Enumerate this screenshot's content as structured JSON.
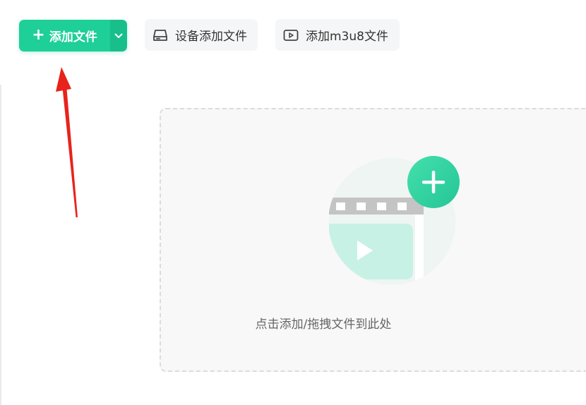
{
  "toolbar": {
    "add_file_label": "添加文件",
    "device_add_label": "设备添加文件",
    "add_m3u8_label": "添加m3u8文件"
  },
  "drop_zone": {
    "hint": "点击添加/拖拽文件到此处"
  },
  "icons": {
    "add_file": "plus-icon",
    "dropdown": "chevron-down-icon",
    "device": "hard-drive-icon",
    "m3u8": "video-play-icon",
    "drop": "video-add-illustration",
    "annotation": "red-arrow"
  },
  "colors": {
    "primary": "#1ecf98",
    "primary_dark": "#19bf8b",
    "secondary_bg": "#f5f6f7",
    "drop_zone_bg": "#f8f8f8",
    "illustration_light": "#c8f1e6",
    "annotation": "#e8231c"
  }
}
